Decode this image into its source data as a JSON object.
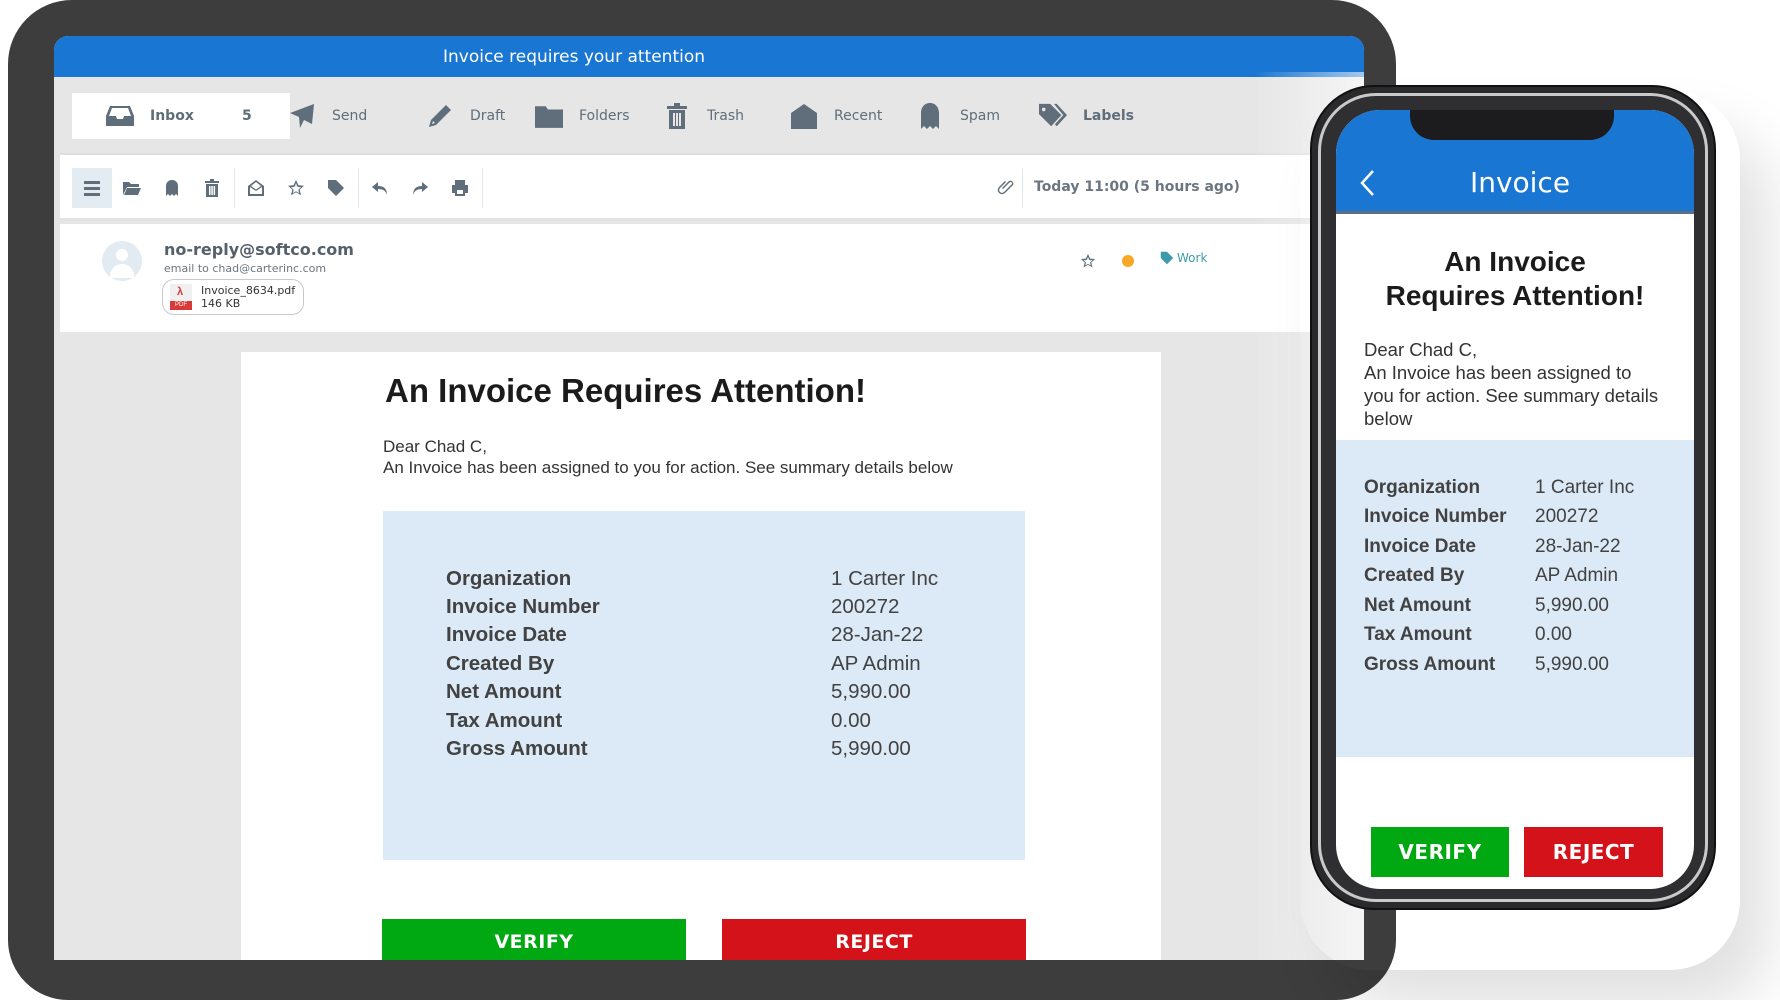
{
  "tablet": {
    "window_title": "Invoice requires your attention",
    "nav": [
      {
        "label": "Inbox",
        "count": "5",
        "icon": "inbox-icon",
        "active": true
      },
      {
        "label": "Send",
        "icon": "send-icon"
      },
      {
        "label": "Draft",
        "icon": "pencil-icon"
      },
      {
        "label": "Folders",
        "icon": "folder-icon"
      },
      {
        "label": "Trash",
        "icon": "trash-icon"
      },
      {
        "label": "Recent",
        "icon": "open-mail-icon"
      },
      {
        "label": "Spam",
        "icon": "ghost-icon"
      },
      {
        "label": "Labels",
        "icon": "tags-icon"
      }
    ],
    "toolbar": {
      "icons": [
        "menu-icon",
        "folder-open-icon",
        "spam-icon",
        "delete-icon",
        "mark-read-icon",
        "star-icon",
        "tag-icon",
        "reply-icon",
        "forward-icon",
        "print-icon"
      ],
      "attachment_icon": "paperclip-icon",
      "date": "Today 11:00 (5 hours ago)"
    },
    "message": {
      "from": "no-reply@softco.com",
      "to": "email to chad@carterinc.com",
      "attachment": {
        "name": "Invoice_8634.pdf",
        "size": "146 KB",
        "type_label": "PDF"
      },
      "label": "Work",
      "label_color": "#3c9cab",
      "status_dot_color": "#f9a825"
    },
    "body": {
      "title": "An Invoice Requires Attention!",
      "greeting": "Dear Chad C,",
      "intro": "An Invoice has been assigned to you for action. See summary details below",
      "details": [
        {
          "label": "Organization",
          "value": "1 Carter Inc"
        },
        {
          "label": "Invoice Number",
          "value": "200272"
        },
        {
          "label": "Invoice Date",
          "value": "28-Jan-22"
        },
        {
          "label": "Created By",
          "value": "AP Admin"
        },
        {
          "label": "Net Amount",
          "value": "5,990.00"
        },
        {
          "label": "Tax Amount",
          "value": "0.00"
        },
        {
          "label": "Gross Amount",
          "value": "5,990.00"
        }
      ],
      "verify_label": "VERIFY",
      "reject_label": "REJECT"
    }
  },
  "phone": {
    "header_title": "Invoice",
    "title_line1": "An Invoice",
    "title_line2": "Requires Attention!",
    "greeting": "Dear Chad C,",
    "intro": "An Invoice has been assigned to you for action. See summary details below",
    "details": [
      {
        "label": "Organization",
        "value": "1 Carter Inc"
      },
      {
        "label": "Invoice Number",
        "value": "200272"
      },
      {
        "label": "Invoice Date",
        "value": "28-Jan-22"
      },
      {
        "label": "Created By",
        "value": "AP Admin"
      },
      {
        "label": "Net Amount",
        "value": "5,990.00"
      },
      {
        "label": "Tax Amount",
        "value": "0.00"
      },
      {
        "label": "Gross Amount",
        "value": "5,990.00"
      }
    ],
    "verify_label": "VERIFY",
    "reject_label": "REJECT"
  },
  "colors": {
    "brand_blue": "#1976d2",
    "verify_green": "#00a812",
    "reject_red": "#d41219",
    "panel_blue": "#dce9f6"
  }
}
